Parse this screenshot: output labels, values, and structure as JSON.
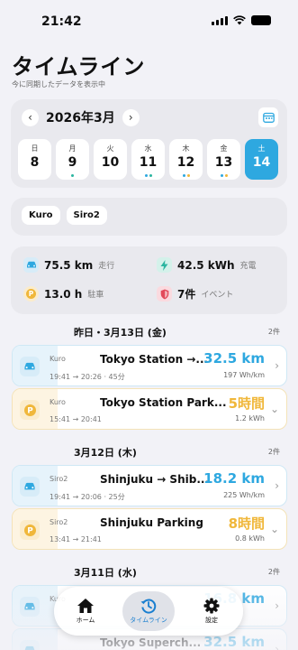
{
  "status_bar": {
    "time": "21:42"
  },
  "header": {
    "title": "タイムライン",
    "subtitle": "今に同期したデータを表示中"
  },
  "calendar": {
    "month_label": "2026年3月",
    "days": [
      {
        "dow": "日",
        "num": "8",
        "dots": []
      },
      {
        "dow": "月",
        "num": "9",
        "dots": [
          "#2bb5a0"
        ]
      },
      {
        "dow": "火",
        "num": "10",
        "dots": []
      },
      {
        "dow": "水",
        "num": "11",
        "dots": [
          "#2ea8e0",
          "#2bb5a0"
        ]
      },
      {
        "dow": "木",
        "num": "12",
        "dots": [
          "#2ea8e0",
          "#f0b73a"
        ]
      },
      {
        "dow": "金",
        "num": "13",
        "dots": [
          "#2ea8e0",
          "#f0b73a"
        ]
      },
      {
        "dow": "土",
        "num": "14",
        "dots": []
      }
    ]
  },
  "vehicles": [
    "Kuro",
    "Siro2"
  ],
  "summary": {
    "distance": {
      "value": "75.5 km",
      "unit": "走行"
    },
    "charge": {
      "value": "42.5 kWh",
      "unit": "充電"
    },
    "parking": {
      "value": "13.0 h",
      "unit": "駐車"
    },
    "events": {
      "value": "7件",
      "unit": "イベント"
    }
  },
  "sections": [
    {
      "title": "昨日・3月13日 (金)",
      "count": "2件",
      "items": [
        {
          "type": "drive",
          "vehicle": "Kuro",
          "time": "19:41 → 20:26 · 45分",
          "name": "Tokyo Station →...",
          "big": "32.5 km",
          "small": "197 Wh/km"
        },
        {
          "type": "park",
          "vehicle": "Kuro",
          "time": "15:41 → 20:41",
          "name": "Tokyo Station Park...",
          "big": "5時間",
          "small": "1.2 kWh"
        }
      ]
    },
    {
      "title": "3月12日 (木)",
      "count": "2件",
      "items": [
        {
          "type": "drive",
          "vehicle": "Siro2",
          "time": "19:41 → 20:06 · 25分",
          "name": "Shinjuku → Shib...",
          "big": "18.2 km",
          "small": "225 Wh/km"
        },
        {
          "type": "park",
          "vehicle": "Siro2",
          "time": "13:41 → 21:41",
          "name": "Shinjuku Parking",
          "big": "8時間",
          "small": "0.8 kWh"
        }
      ]
    },
    {
      "title": "3月11日 (水)",
      "count": "2件",
      "items": [
        {
          "type": "drive",
          "vehicle": "Kuro",
          "time": "",
          "name": "",
          "big": "16.8 km",
          "small": ""
        },
        {
          "type": "drive",
          "vehicle": "",
          "time": "",
          "name": "Tokyo Superch...",
          "big": "32.5 km",
          "small": ""
        }
      ]
    }
  ],
  "tabs": [
    {
      "label": "ホーム",
      "icon": "home-icon"
    },
    {
      "label": "タイムライン",
      "icon": "clock-history-icon"
    },
    {
      "label": "設定",
      "icon": "gear-icon"
    }
  ],
  "colors": {
    "accent": "#2ea8e0",
    "parking": "#f0b73a",
    "teal": "#2bb5a0",
    "event": "#e24a5a"
  }
}
